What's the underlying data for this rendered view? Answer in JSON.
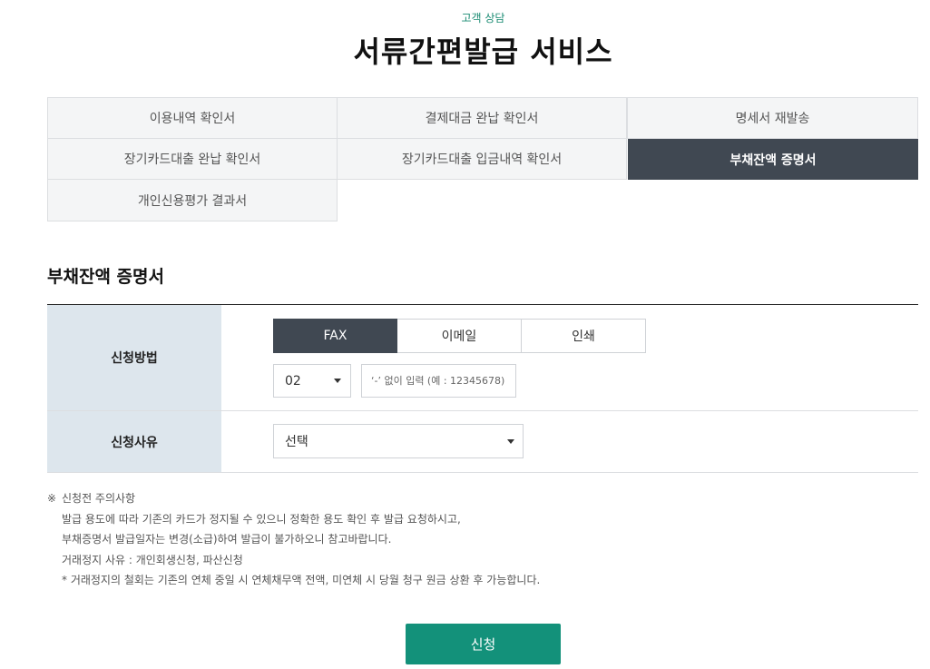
{
  "header": {
    "category": "고객 상담",
    "title": "서류간편발급 서비스"
  },
  "tabs": [
    {
      "label": "이용내역 확인서",
      "active": false
    },
    {
      "label": "결제대금 완납 확인서",
      "active": false
    },
    {
      "label": "명세서 재발송",
      "active": false
    },
    {
      "label": "장기카드대출 완납 확인서",
      "active": false
    },
    {
      "label": "장기카드대출 입금내역 확인서",
      "active": false
    },
    {
      "label": "부채잔액 증명서",
      "active": true
    },
    {
      "label": "개인신용평가 결과서",
      "active": false
    }
  ],
  "form": {
    "section_title": "부채잔액 증명서",
    "method": {
      "label": "신청방법",
      "options": [
        "FAX",
        "이메일",
        "인쇄"
      ],
      "selected": "FAX",
      "area_code": "02",
      "fax_placeholder": "‘-’ 없이 입력 (예 : 12345678)"
    },
    "reason": {
      "label": "신청사유",
      "selected": "선택"
    }
  },
  "notice": {
    "mark": "※",
    "title": "신청전 주의사항",
    "lines": [
      "발급 용도에 따라 기존의 카드가 정지될 수 있으니 정확한 용도 확인 후 발급 요청하시고,",
      "부채증명서 발급일자는 변경(소급)하여 발급이 불가하오니 참고바랍니다.",
      "거래정지 사유 : 개인회생신청, 파산신청",
      "* 거래정지의 철회는 기존의 연체 중일 시 연체채무액 전액, 미연체 시 당월 청구 원금 상환 후 가능합니다."
    ]
  },
  "submit_label": "신청",
  "colors": {
    "accent": "#13917a",
    "active_tab": "#404852",
    "label_bg": "#dde6ed"
  }
}
